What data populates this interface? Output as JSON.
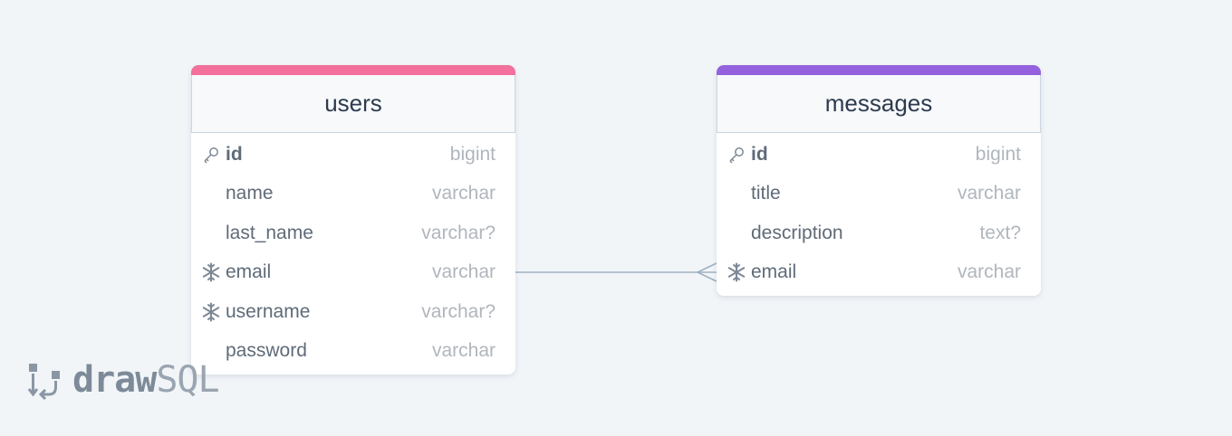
{
  "colors": {
    "users_accent": "#f2709b",
    "messages_accent": "#9362dc",
    "relation_line": "#9fb1c2"
  },
  "tables": [
    {
      "name": "users",
      "columns": [
        {
          "name": "id",
          "type": "bigint",
          "icon": "key-icon"
        },
        {
          "name": "name",
          "type": "varchar",
          "icon": ""
        },
        {
          "name": "last_name",
          "type": "varchar?",
          "icon": ""
        },
        {
          "name": "email",
          "type": "varchar",
          "icon": "snowflake-icon"
        },
        {
          "name": "username",
          "type": "varchar?",
          "icon": "snowflake-icon"
        },
        {
          "name": "password",
          "type": "varchar",
          "icon": ""
        }
      ]
    },
    {
      "name": "messages",
      "columns": [
        {
          "name": "id",
          "type": "bigint",
          "icon": "key-icon"
        },
        {
          "name": "title",
          "type": "varchar",
          "icon": ""
        },
        {
          "name": "description",
          "type": "text?",
          "icon": ""
        },
        {
          "name": "email",
          "type": "varchar",
          "icon": "snowflake-icon"
        }
      ]
    }
  ],
  "relation": {
    "from": "users.email",
    "to": "messages.email",
    "cardinality": "one-to-many"
  },
  "logo": {
    "part1": "draw",
    "part2": "SQL"
  }
}
